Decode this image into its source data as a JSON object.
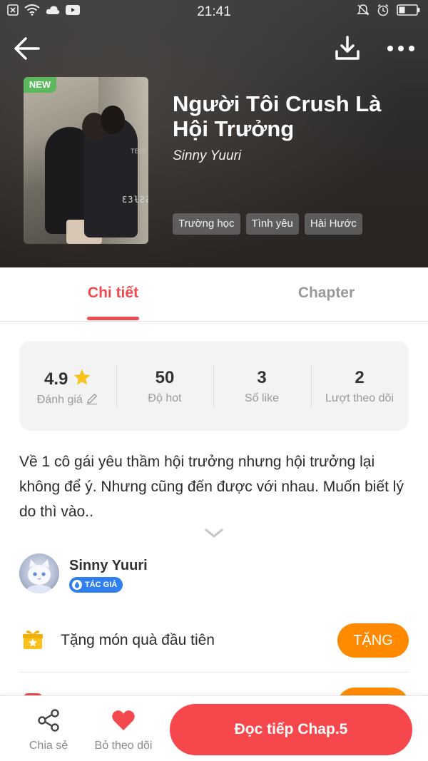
{
  "status_bar": {
    "time": "21:41",
    "left_icons": [
      "close-box-icon",
      "wifi-icon",
      "cloud-icon",
      "youtube-icon"
    ],
    "right_icons": [
      "bell-off-icon",
      "alarm-icon",
      "battery-icon"
    ]
  },
  "topbar": {
    "back_icon": "arrow-left-icon",
    "download_icon": "download-icon",
    "more_icon": "more-dots-icon"
  },
  "book": {
    "new_badge": "NEW",
    "title": "Người Tôi Crush Là Hội Trưởng",
    "author": "Sinny Yuuri",
    "cover_print": "Ɛ3ƚƧƧ",
    "cover_print_small": "TEƧИ",
    "tags": [
      "Trường học",
      "Tình yêu",
      "Hài Hước"
    ]
  },
  "tabs": [
    {
      "label": "Chi tiết",
      "active": true
    },
    {
      "label": "Chapter",
      "active": false
    }
  ],
  "stats": [
    {
      "value": "4.9",
      "label": "Đánh giá",
      "icon": "star-icon",
      "label_icon": "pencil-icon"
    },
    {
      "value": "50",
      "label": "Độ hot"
    },
    {
      "value": "3",
      "label": "Số like"
    },
    {
      "value": "2",
      "label": "Lượt theo dõi"
    }
  ],
  "description": "Về 1 cô gái yêu thầm hội trưởng nhưng hội trưởng lại không để ý. Nhưng cũng đến được với nhau. Muốn biết lý do thì vào..",
  "author_section": {
    "name": "Sinny Yuuri",
    "badge": "TÁC GIẢ"
  },
  "gift": {
    "text": "Tặng món quà đầu tiên",
    "button": "TẶNG"
  },
  "bottom_bar": {
    "share_label": "Chia sẻ",
    "follow_label": "Bỏ theo dõi",
    "read_button": "Đọc tiếp Chap.5"
  },
  "colors": {
    "accent_red": "#f2484e",
    "gift_orange": "#ff8a00",
    "new_green": "#5cb85c",
    "author_blue": "#2f7ff0",
    "star_yellow": "#f7c21b"
  }
}
